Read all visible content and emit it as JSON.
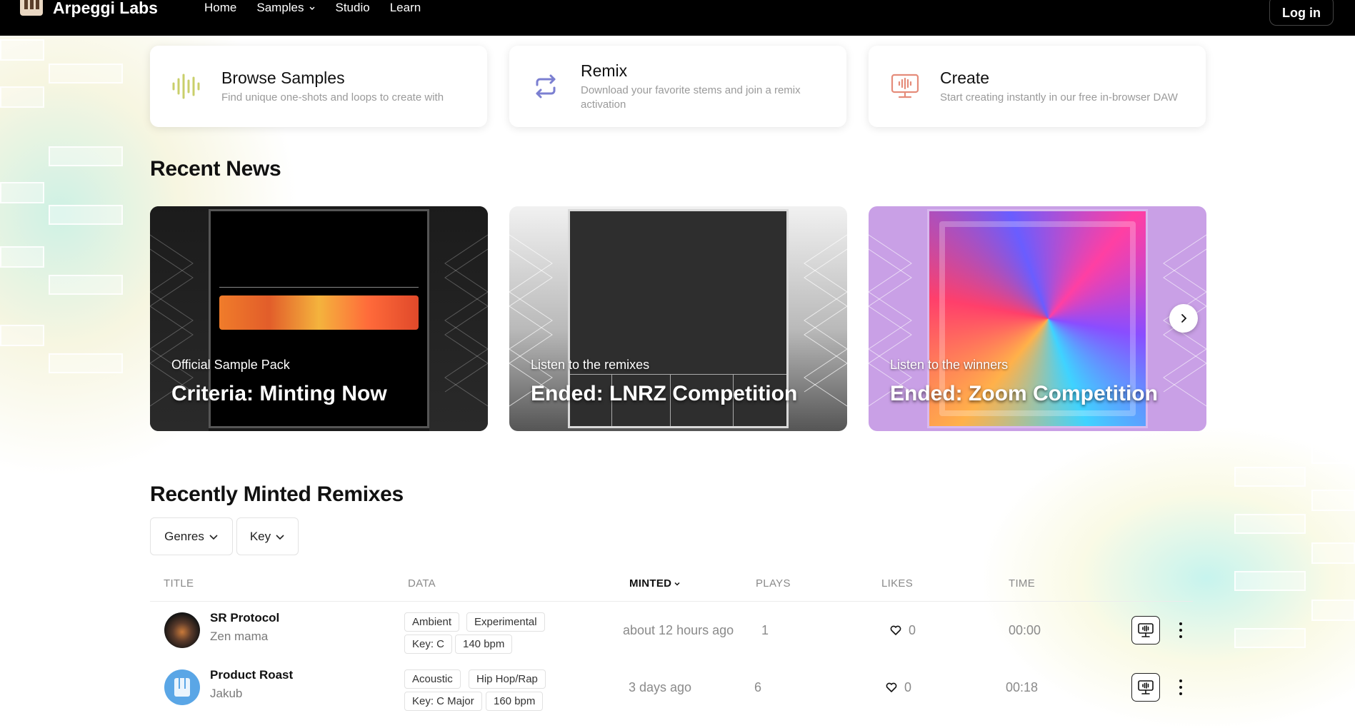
{
  "nav": {
    "brand": "Arpeggi Labs",
    "links": [
      "Home",
      "Samples",
      "Studio",
      "Learn"
    ],
    "login_label": "Log in"
  },
  "features": [
    {
      "title": "Browse Samples",
      "desc": "Find unique one-shots and loops to create with",
      "icon": "waveform-icon",
      "color": "#c9cf6b"
    },
    {
      "title": "Remix",
      "desc": "Download your favorite stems and join a remix activation",
      "icon": "repeat-arrows-icon",
      "color": "#7b7fd1"
    },
    {
      "title": "Create",
      "desc": "Start creating instantly in our free in-browser DAW",
      "icon": "monitor-waveform-icon",
      "color": "#e58c7a"
    }
  ],
  "news": {
    "heading": "Recent News",
    "cards": [
      {
        "sub": "Official Sample Pack",
        "title": "Criteria: Minting Now"
      },
      {
        "sub": "Listen to the remixes",
        "title": "Ended: LNRZ Competition"
      },
      {
        "sub": "Listen to the winners",
        "title": "Ended: Zoom Competition"
      }
    ]
  },
  "remixes": {
    "heading": "Recently Minted Remixes",
    "filters": [
      "Genres",
      "Key"
    ],
    "columns": [
      "TITLE",
      "DATA",
      "MINTED",
      "PLAYS",
      "LIKES",
      "TIME"
    ],
    "rows": [
      {
        "title": "SR Protocol",
        "artist": "Zen mama",
        "genres": [
          "Ambient",
          "Experimental"
        ],
        "key": "Key: C",
        "bpm": "140 bpm",
        "minted": "about 12 hours ago",
        "plays": "1",
        "likes": "0",
        "time": "00:00"
      },
      {
        "title": "Product Roast",
        "artist": "Jakub",
        "genres": [
          "Acoustic",
          "Hip Hop/Rap"
        ],
        "key": "Key: C Major",
        "bpm": "160 bpm",
        "minted": "3 days ago",
        "plays": "6",
        "likes": "0",
        "time": "00:18"
      }
    ]
  },
  "colors": {
    "nav_bg": "#000000",
    "zoom_card_bg": "#c9a0e6"
  }
}
